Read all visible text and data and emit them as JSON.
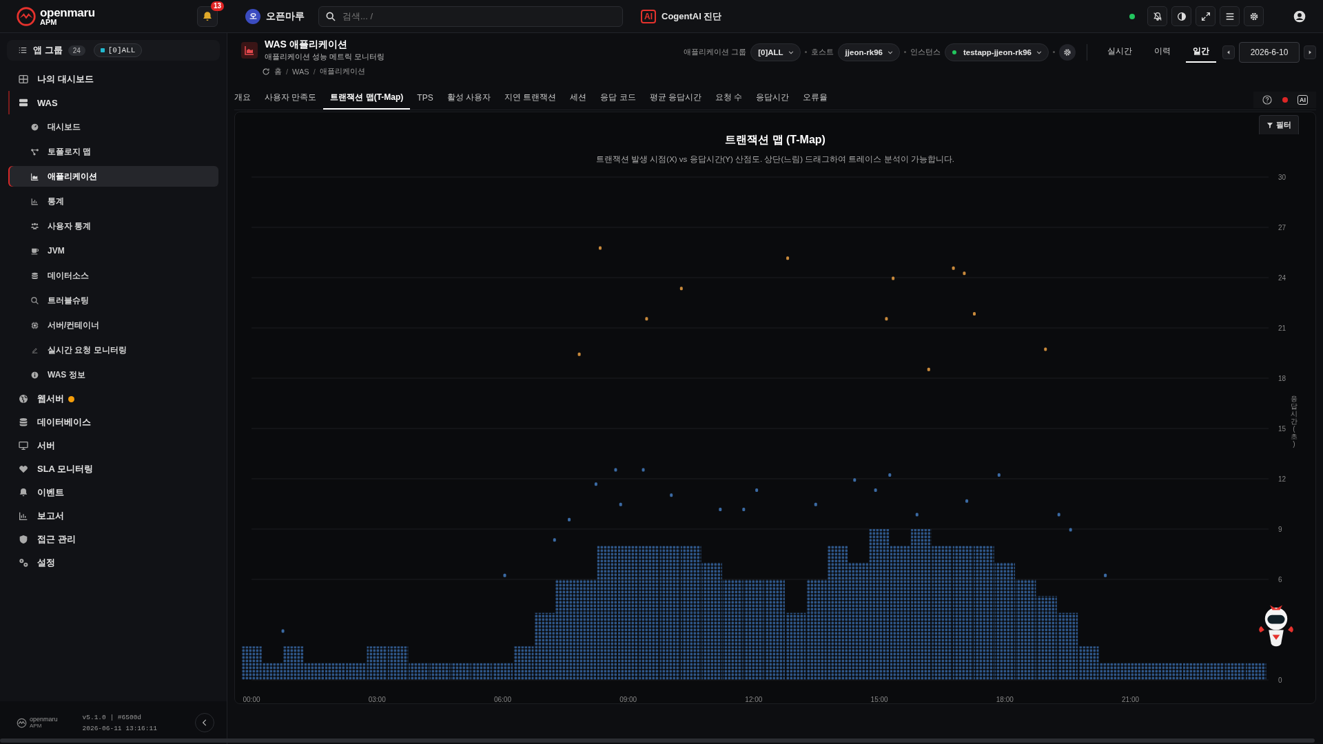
{
  "topbar": {
    "logo": {
      "name": "openmaru",
      "sub": "APM"
    },
    "notifications": {
      "count": "13"
    },
    "workspace": {
      "initial": "오",
      "name": "오픈마루"
    },
    "search": {
      "placeholder": "검색... /"
    },
    "ai_button": {
      "badge": "AI",
      "label": "CogentAI 진단"
    },
    "status_online": true
  },
  "sidebar": {
    "group": {
      "label": "앱 그룹",
      "count": "24",
      "chip": "[0]ALL"
    },
    "items": [
      {
        "label": "나의 대시보드",
        "selected": false
      },
      {
        "label": "WAS",
        "selected": false,
        "expanded": true,
        "children": [
          {
            "label": "대시보드",
            "selected": false
          },
          {
            "label": "토폴로지 맵",
            "selected": false
          },
          {
            "label": "애플리케이션",
            "selected": true
          },
          {
            "label": "통계",
            "selected": false
          },
          {
            "label": "사용자 통계",
            "selected": false
          },
          {
            "label": "JVM",
            "selected": false
          },
          {
            "label": "데이터소스",
            "selected": false
          },
          {
            "label": "트러블슈팅",
            "selected": false
          },
          {
            "label": "서버/컨테이너",
            "selected": false
          },
          {
            "label": "실시간 요청 모니터링",
            "selected": false
          },
          {
            "label": "WAS 정보",
            "selected": false
          }
        ]
      },
      {
        "label": "웹서버",
        "selected": false,
        "color": "#f59e0b"
      },
      {
        "label": "데이터베이스",
        "selected": false
      },
      {
        "label": "서버",
        "selected": false
      },
      {
        "label": "SLA 모니터링",
        "selected": false
      },
      {
        "label": "이벤트",
        "selected": false
      },
      {
        "label": "보고서",
        "selected": false
      },
      {
        "label": "접근 관리",
        "selected": false
      },
      {
        "label": "설정",
        "selected": false
      }
    ],
    "footer": {
      "logo": "openmaru",
      "logo_sub": "APM",
      "version": "v5.1.0 | #6500d",
      "timestamp": "2026-06-11 13:16:11"
    }
  },
  "header": {
    "title": "WAS 애플리케이션",
    "subtitle": "애플리케이션 성능 메트릭 모니터링",
    "breadcrumb": [
      "홈",
      "WAS",
      "애플리케이션"
    ],
    "breadcrumb_separator": "/",
    "filters": [
      {
        "label": "애플리케이션 그룹",
        "value": "[0]ALL",
        "status": false
      },
      {
        "label": "호스트",
        "value": "jjeon-rk96",
        "status": false
      },
      {
        "label": "인스턴스",
        "value": "testapp-jjeon-rk96",
        "status": true
      }
    ],
    "modes": [
      {
        "label": "실시간",
        "selected": false
      },
      {
        "label": "이력",
        "selected": false
      },
      {
        "label": "일간",
        "selected": true
      }
    ],
    "date": "2026-6-10"
  },
  "tabs": [
    {
      "label": "개요",
      "selected": false
    },
    {
      "label": "사용자 만족도",
      "selected": false
    },
    {
      "label": "트랜잭션 맵(T-Map)",
      "selected": true
    },
    {
      "label": "TPS",
      "selected": false
    },
    {
      "label": "활성 사용자",
      "selected": false
    },
    {
      "label": "지연 트랜잭션",
      "selected": false
    },
    {
      "label": "세션",
      "selected": false
    },
    {
      "label": "응답 코드",
      "selected": false
    },
    {
      "label": "평균 응답시간",
      "selected": false
    },
    {
      "label": "요청 수",
      "selected": false
    },
    {
      "label": "응답시간",
      "selected": false
    },
    {
      "label": "오류율",
      "selected": false
    }
  ],
  "tab_tools": {
    "ai_badge": "AI",
    "recording": true
  },
  "chart": {
    "filter_button": "필터",
    "description": "트랜잭션 발생 시점(X) vs 응답시간(Y) 산점도. 상단(느림) 드래그하여 트레이스 분석이 가능합니다.",
    "chart_data": {
      "type": "scatter",
      "title": "트랜잭션 맵 (T-Map)",
      "ylabel": "응답시간(초)",
      "xlim": [
        0,
        24.3
      ],
      "ylim": [
        0,
        30
      ],
      "grid": true,
      "xticks": [
        {
          "value": 0,
          "label": "00:00"
        },
        {
          "value": 3,
          "label": "03:00"
        },
        {
          "value": 6,
          "label": "06:00"
        },
        {
          "value": 9,
          "label": "09:00"
        },
        {
          "value": 12,
          "label": "12:00"
        },
        {
          "value": 15,
          "label": "15:00"
        },
        {
          "value": 18,
          "label": "18:00"
        },
        {
          "value": 21,
          "label": "21:00"
        }
      ],
      "yticks": [
        0,
        6,
        9,
        12,
        15,
        18,
        21,
        24,
        27,
        30
      ],
      "series": [
        {
          "color": "#2e5688",
          "x": [
            0,
            0.5,
            1,
            1.5,
            2,
            2.5,
            3,
            3.5,
            4,
            4.5,
            5,
            5.5,
            6,
            6.5,
            7,
            7.5,
            8,
            8.5,
            9,
            9.5,
            10,
            10.5,
            11,
            11.5,
            12,
            12.5,
            13,
            13.5,
            14,
            14.5,
            15,
            15.5,
            16,
            16.5,
            17,
            17.5,
            18,
            18.5,
            19,
            19.5,
            20,
            20.5,
            21,
            21.5,
            22,
            22.5,
            23,
            23.5,
            24
          ],
          "values": [
            0.5,
            0.5,
            0.5,
            0.5,
            0.5,
            0.5,
            0.5,
            0.5,
            0.5,
            0.5,
            0.5,
            0.5,
            0.5,
            0.5,
            0.5,
            0.5,
            0.5,
            0.5,
            0.5,
            0.5,
            0.5,
            0.5,
            0.5,
            0.5,
            0.5,
            0.5,
            0.5,
            0.5,
            0.5,
            0.5,
            0.5,
            0.5,
            0.5,
            0.5,
            0.5,
            0.5,
            0.5,
            0.5,
            0.5,
            0.5,
            0.5,
            0.5,
            0.5,
            0.5,
            0.5,
            0.5,
            0.5,
            0.5,
            0.5
          ]
        },
        {
          "color": "#2e5688",
          "x": [
            0,
            1,
            3,
            3.5,
            6.5,
            7,
            7.5,
            8,
            8.5,
            9,
            9.5,
            10,
            10.5,
            11,
            11.5,
            12,
            12.5,
            13,
            13.5,
            14,
            14.5,
            15,
            15.5,
            16,
            16.5,
            17,
            17.5,
            18,
            18.5,
            19,
            19.5,
            20
          ],
          "values": [
            1.5,
            1.5,
            1.5,
            1.5,
            1.5,
            1.5,
            1.5,
            1.5,
            1.5,
            1.5,
            1.5,
            1.5,
            1.5,
            1.5,
            1.5,
            1.5,
            1.5,
            1.5,
            1.5,
            1.5,
            1.5,
            1.5,
            1.5,
            1.5,
            1.5,
            1.5,
            1.5,
            1.5,
            1.5,
            1.5,
            1.5,
            1.5
          ]
        },
        {
          "color": "#2e5688",
          "x": [
            7,
            7.5,
            8,
            8.5,
            9,
            9.5,
            10,
            10.5,
            11,
            11.5,
            12,
            12.5,
            13,
            13.5,
            14,
            14.5,
            15,
            15.5,
            16,
            16.5,
            17,
            17.5,
            18,
            18.5,
            19,
            19.5
          ],
          "values": [
            2.5,
            2.5,
            2.5,
            2.5,
            2.5,
            2.5,
            2.5,
            2.5,
            2.5,
            2.5,
            2.5,
            2.5,
            2.5,
            2.5,
            2.5,
            2.5,
            2.5,
            2.5,
            2.5,
            2.5,
            2.5,
            2.5,
            2.5,
            2.5,
            2.5,
            2.5
          ]
        },
        {
          "color": "#2e5688",
          "x": [
            7,
            7.5,
            8,
            8.5,
            9,
            9.5,
            10,
            10.5,
            11,
            11.5,
            12,
            12.5,
            13,
            13.5,
            14,
            14.5,
            15,
            15.5,
            16,
            16.5,
            17,
            17.5,
            18,
            18.5,
            19,
            19.5
          ],
          "values": [
            3.5,
            3.5,
            3.5,
            3.5,
            3.5,
            3.5,
            3.5,
            3.5,
            3.5,
            3.5,
            3.5,
            3.5,
            3.5,
            3.5,
            3.5,
            3.5,
            3.5,
            3.5,
            3.5,
            3.5,
            3.5,
            3.5,
            3.5,
            3.5,
            3.5,
            3.5
          ]
        },
        {
          "color": "#2e5688",
          "x": [
            7.5,
            8,
            8.5,
            9,
            9.5,
            10,
            10.5,
            11,
            11.5,
            12,
            12.5,
            13.5,
            14,
            14.5,
            15,
            15.5,
            16,
            16.5,
            17,
            17.5,
            18,
            18.5,
            19
          ],
          "values": [
            4.5,
            4.5,
            4.5,
            4.5,
            4.5,
            4.5,
            4.5,
            4.5,
            4.5,
            4.5,
            4.5,
            4.5,
            4.5,
            4.5,
            4.5,
            4.5,
            4.5,
            4.5,
            4.5,
            4.5,
            4.5,
            4.5,
            4.5
          ]
        },
        {
          "color": "#2e5688",
          "x": [
            7.5,
            8,
            8.5,
            9,
            9.5,
            10,
            10.5,
            11,
            11.5,
            12,
            12.5,
            13.5,
            14,
            14.5,
            15,
            15.5,
            16,
            16.5,
            17,
            17.5,
            18,
            18.5
          ],
          "values": [
            5.5,
            5.5,
            5.5,
            5.5,
            5.5,
            5.5,
            5.5,
            5.5,
            5.5,
            5.5,
            5.5,
            5.5,
            5.5,
            5.5,
            5.5,
            5.5,
            5.5,
            5.5,
            5.5,
            5.5,
            5.5,
            5.5
          ]
        },
        {
          "color": "#2e5688",
          "x": [
            8.5,
            9,
            9.5,
            10,
            10.5,
            11,
            14,
            14.5,
            15,
            15.5,
            16,
            16.5,
            17,
            17.5,
            18
          ],
          "values": [
            6.5,
            6.5,
            6.5,
            6.5,
            6.5,
            6.5,
            6.5,
            6.5,
            6.5,
            6.5,
            6.5,
            6.5,
            6.5,
            6.5,
            6.5
          ]
        },
        {
          "color": "#2e5688",
          "x": [
            8.5,
            9,
            9.5,
            10,
            10.5,
            14,
            15,
            15.5,
            16,
            16.5,
            17,
            17.5
          ],
          "values": [
            7.5,
            7.5,
            7.5,
            7.5,
            7.5,
            7.5,
            7.5,
            7.5,
            7.5,
            7.5,
            7.5,
            7.5
          ]
        },
        {
          "color": "#2e5688",
          "x": [
            15,
            16
          ],
          "values": [
            8.5,
            8.5
          ]
        },
        {
          "color": "#3b6aa3",
          "x": [
            8.7,
            9.36,
            15.25,
            17.86,
            8.23,
            14.41,
            12.07,
            10.03,
            14.91,
            17.09,
            7.59,
            8.82,
            11.2,
            11.76,
            13.48,
            15.9,
            19.29,
            19.57,
            7.24,
            6.05,
            0.75,
            20.4
          ],
          "values": [
            12.53,
            12.53,
            12.23,
            12.23,
            11.68,
            11.93,
            11.32,
            11.02,
            11.32,
            10.67,
            9.56,
            10.47,
            10.17,
            10.17,
            10.47,
            9.86,
            9.86,
            8.96,
            8.35,
            6.24,
            2.92,
            6.24
          ]
        },
        {
          "color": "#c98a3c",
          "x": [
            8.33,
            12.81,
            10.27,
            15.33,
            16.77,
            17.03,
            9.44,
            15.17,
            17.27,
            7.83,
            16.18,
            18.97
          ],
          "values": [
            25.77,
            25.16,
            23.35,
            23.96,
            24.56,
            24.26,
            21.54,
            21.54,
            21.84,
            19.43,
            18.52,
            19.73
          ]
        }
      ]
    }
  }
}
